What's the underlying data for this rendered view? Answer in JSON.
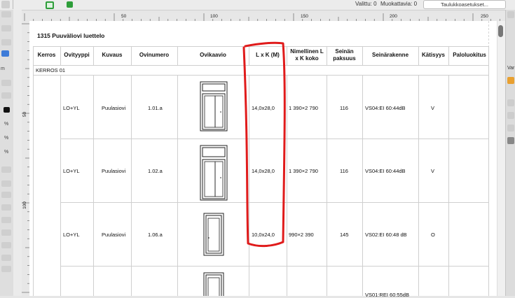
{
  "toolbar": {
    "selected_text": "Valittu: 0",
    "edit_text": "Muokattavia: 0",
    "layout_settings_label": "Taulukkoasetukset..."
  },
  "left_panel": {
    "unit_label": "m",
    "pct_1": "%",
    "pct_2": "%",
    "pct_3": "%"
  },
  "right_panel": {
    "label_var": "Var"
  },
  "rulers": {
    "top_labels": [
      "50",
      "100",
      "150",
      "200",
      "250"
    ],
    "left_labels": [
      "50",
      "100"
    ]
  },
  "schedule": {
    "title": "1315 Puuväliovi luettelo",
    "columns": [
      "Kerros",
      "Ovityyppi",
      "Kuvaus",
      "Ovinumero",
      "Ovikaavio",
      "L x K (M)",
      "Nimellinen L x K koko",
      "Seinän paksuus",
      "Seinärakenne",
      "Kätisyys",
      "Paloluokitus"
    ],
    "group_label": "KERROS 01",
    "rows": [
      {
        "floor": "",
        "type": "LO+YL",
        "desc": "Puulasiovi",
        "number": "1.01.a",
        "size": "14,0x28,0",
        "nominal": "1 390×2 790",
        "thickness": "116",
        "structure": "VS04:EI 60:44dB",
        "handing": "V",
        "fire": ""
      },
      {
        "floor": "",
        "type": "LO+YL",
        "desc": "Puulasiovi",
        "number": "1.02.a",
        "size": "14,0x28,0",
        "nominal": "1 390×2 790",
        "thickness": "116",
        "structure": "VS04:EI 60:44dB",
        "handing": "V",
        "fire": ""
      },
      {
        "floor": "",
        "type": "LO+YL",
        "desc": "Puulasiovi",
        "number": "1.06.a",
        "size": "10,0x24,0",
        "nominal": "990×2 390",
        "thickness": "145",
        "structure": "VS02:EI 60:48 dB",
        "handing": "O",
        "fire": ""
      },
      {
        "floor": "",
        "type": "",
        "desc": "",
        "number": "",
        "size": "",
        "nominal": "",
        "thickness": "",
        "structure": "VS01:REI 60:55dB",
        "handing": "",
        "fire": ""
      }
    ]
  },
  "colors": {
    "annotation": "#e01b1b",
    "accent_green": "#2e9e3a"
  }
}
